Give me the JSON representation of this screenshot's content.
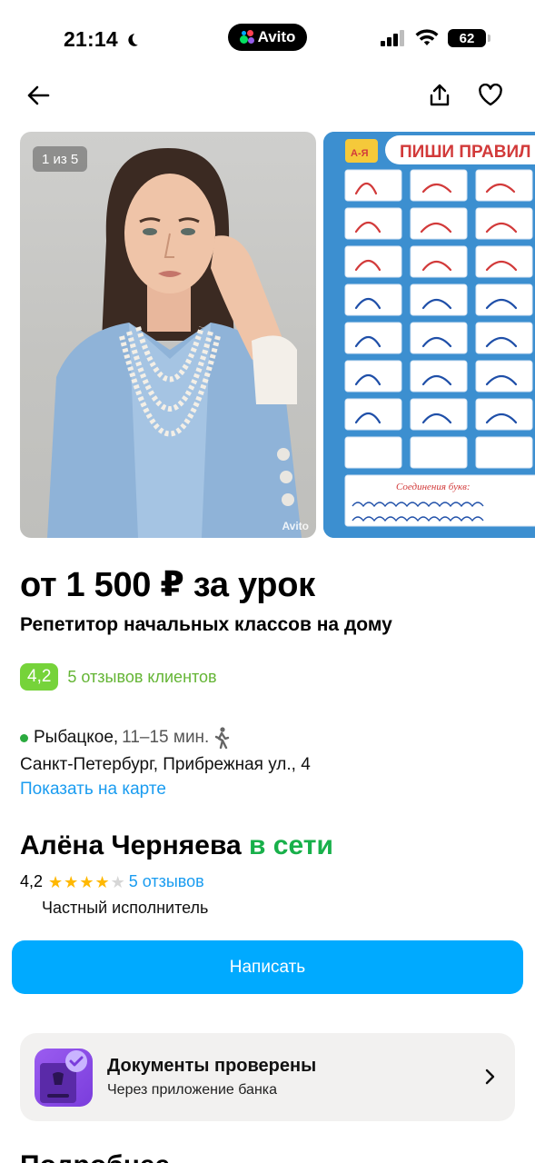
{
  "status_bar": {
    "time": "21:14",
    "app_pill": "Avito",
    "battery": "62"
  },
  "gallery": {
    "counter": "1 из 5",
    "watermark": "Avito",
    "poster_title": "ПИШИ ПРАВИЛ",
    "poster_logo": "А-Я",
    "poster_footer": "Соединения букв:"
  },
  "listing": {
    "price": "от 1 500 ₽ за урок",
    "title": "Репетитор начальных классов на дому",
    "rating": "4,2",
    "reviews": "5 отзывов клиентов"
  },
  "location": {
    "metro": "Рыбацкое,",
    "time": "11–15 мин.",
    "address": "Санкт-Петербург, Прибрежная ул., 4",
    "map_link": "Показать на карте"
  },
  "seller": {
    "name": "Алёна Черняева",
    "status": "в сети",
    "rating": "4,2",
    "stars_filled": 4,
    "reviews": "5 отзывов",
    "type": "Частный исполнитель"
  },
  "actions": {
    "write": "Написать"
  },
  "docs": {
    "title": "Документы проверены",
    "subtitle": "Через приложение банка"
  },
  "next_section_heading": "Подробнее"
}
